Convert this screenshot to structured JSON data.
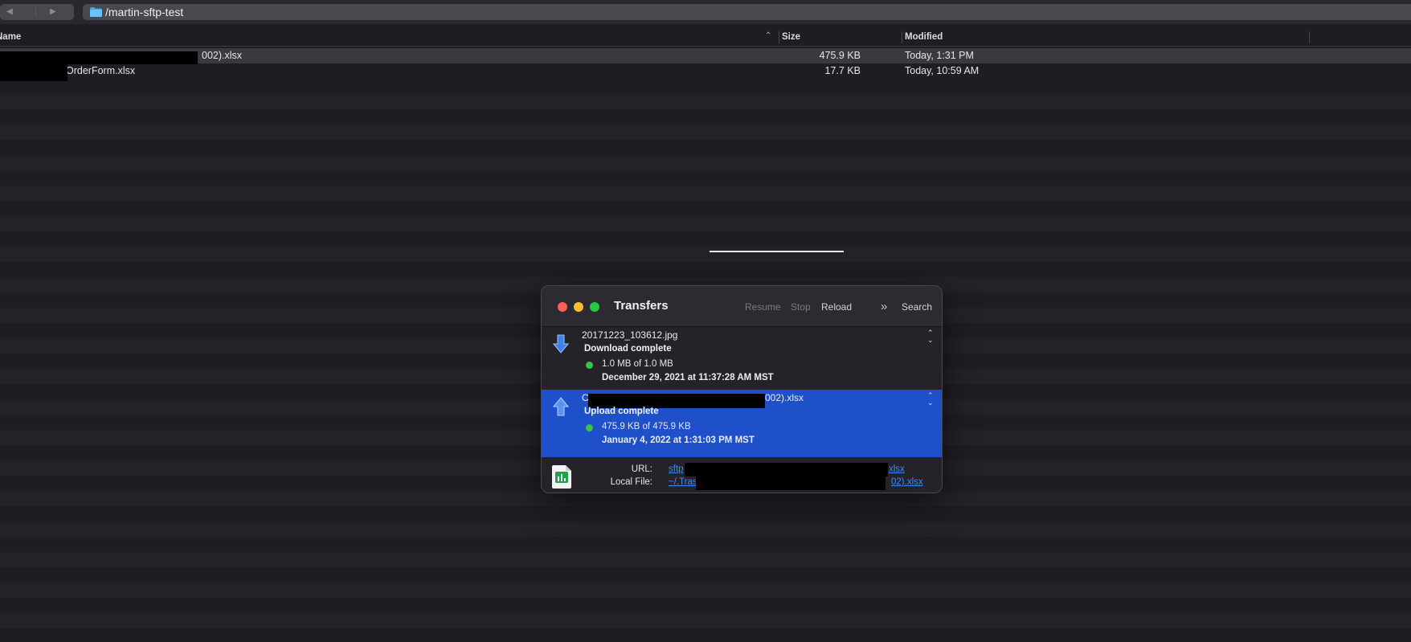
{
  "toolbar": {
    "back_glyph": "◀",
    "forward_glyph": "▶",
    "path": "/martin-sftp-test",
    "path_icon": "folder-icon"
  },
  "file_list": {
    "columns": {
      "name": "Name",
      "size": "Size",
      "modified": "Modified"
    },
    "rows": [
      {
        "name": "002).xlsx",
        "size": "475.9 KB",
        "modified": "Today, 1:31 PM",
        "selected": true
      },
      {
        "name": "OrderForm.xlsx",
        "size": "17.7 KB",
        "modified": "Today, 10:59 AM",
        "selected": false
      }
    ]
  },
  "transfers": {
    "title": "Transfers",
    "toolbar": {
      "resume": "Resume",
      "stop": "Stop",
      "reload": "Reload",
      "more_glyph": "»",
      "search": "Search"
    },
    "items": [
      {
        "direction": "download",
        "icon": "download-arrow-icon",
        "name": "20171223_103612.jpg",
        "status": "Download complete",
        "progress": "1.0 MB of 1.0 MB",
        "date": "December 29, 2021 at 11:37:28 AM MST",
        "selected": false
      },
      {
        "direction": "upload",
        "icon": "upload-arrow-icon",
        "name_prefix": "C",
        "name_suffix": "002).xlsx",
        "status": "Upload complete",
        "progress": "475.9 KB of 475.9 KB",
        "date": "January 4, 2022 at 1:31:03 PM MST",
        "selected": true
      }
    ],
    "details": {
      "file_icon": "excel-file-icon",
      "url_label": "URL:",
      "url_prefix": "sftp",
      "url_suffix": "xlsx",
      "local_label": "Local File:",
      "local_prefix": "~/.Tras",
      "local_suffix": "02).xlsx"
    }
  },
  "colors": {
    "background": "#1f1d23",
    "selection_blue": "#1e50c9",
    "link": "#3b8cf5",
    "status_dot": "#33c747"
  }
}
